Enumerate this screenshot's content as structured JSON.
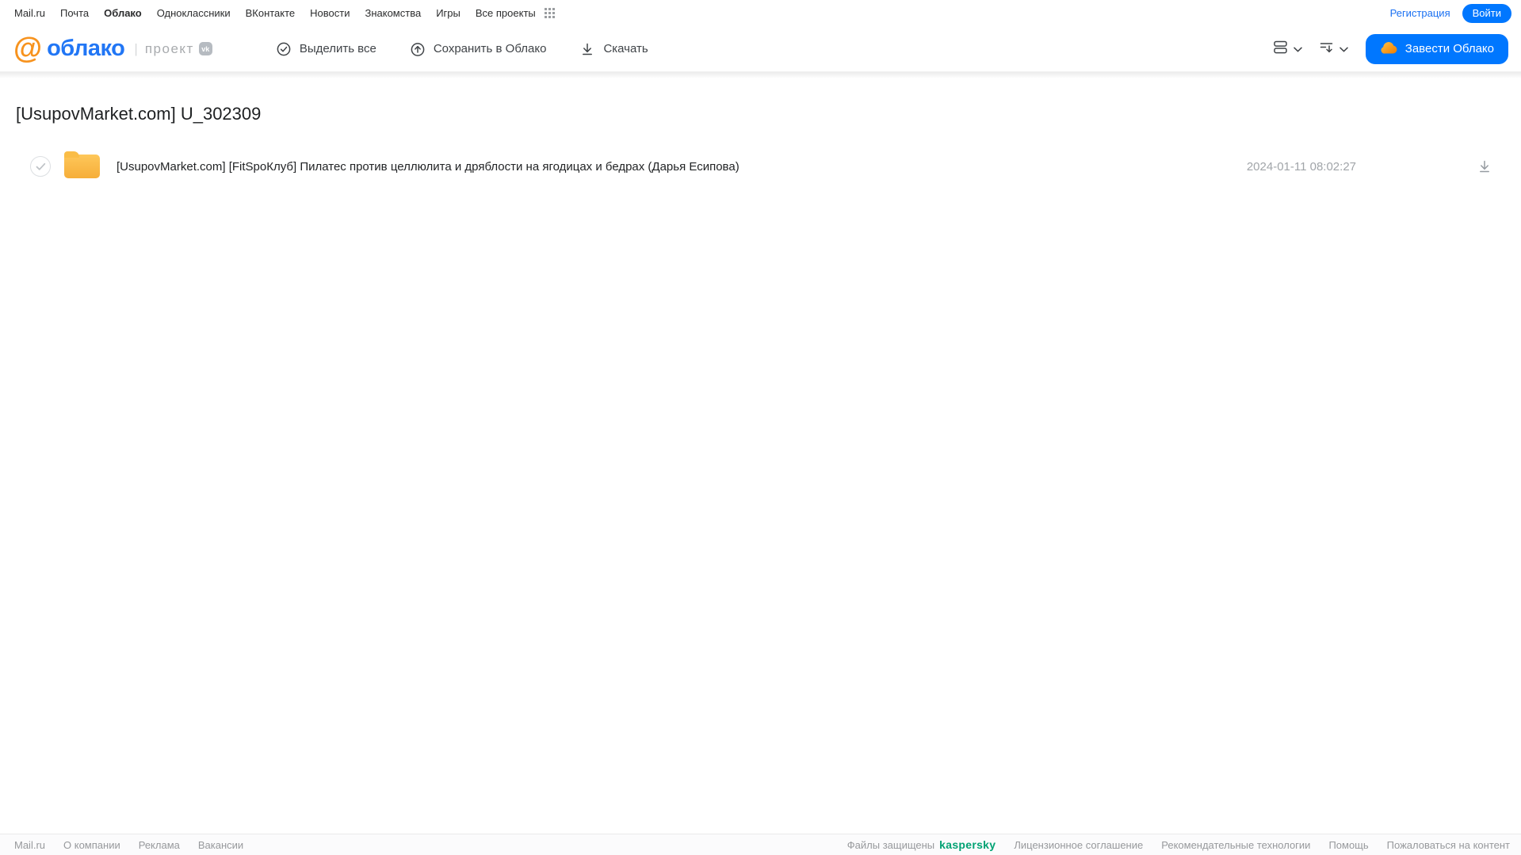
{
  "topnav": {
    "links": [
      "Mail.ru",
      "Почта",
      "Облако",
      "Одноклассники",
      "ВКонтакте",
      "Новости",
      "Знакомства",
      "Игры",
      "Все проекты"
    ],
    "registration_label": "Регистрация",
    "login_label": "Войти"
  },
  "header": {
    "logo_at": "@",
    "logo_text": "облако",
    "logo_sep": "|",
    "project_label": "проект",
    "vk_badge": "vk",
    "toolbar": {
      "select_all_label": "Выделить все",
      "save_to_cloud_label": "Сохранить в Облако",
      "download_label": "Скачать"
    },
    "get_cloud_label": "Завести Облако"
  },
  "main": {
    "page_title": "[UsupovMarket.com] U_302309",
    "files": [
      {
        "name": "[UsupovMarket.com] [FitSpoКлуб] Пилатес против целлюлита и дряблости на ягодицах и бедрах (Дарья Есипова)",
        "modified": "2024-01-11 08:02:27"
      }
    ]
  },
  "footer": {
    "left_links": [
      "Mail.ru",
      "О компании",
      "Реклама",
      "Вакансии"
    ],
    "protected_label": "Файлы защищены",
    "kaspersky_label": "kaspersky",
    "right_links": [
      "Лицензионное соглашение",
      "Рекомендательные технологии",
      "Помощь",
      "Пожаловаться на контент"
    ]
  },
  "colors": {
    "accent_blue": "#0077ff",
    "logo_blue": "#2176f5",
    "logo_orange": "#f7931e",
    "folder_orange": "#fbb03c",
    "kaspersky_green": "#00a273"
  }
}
